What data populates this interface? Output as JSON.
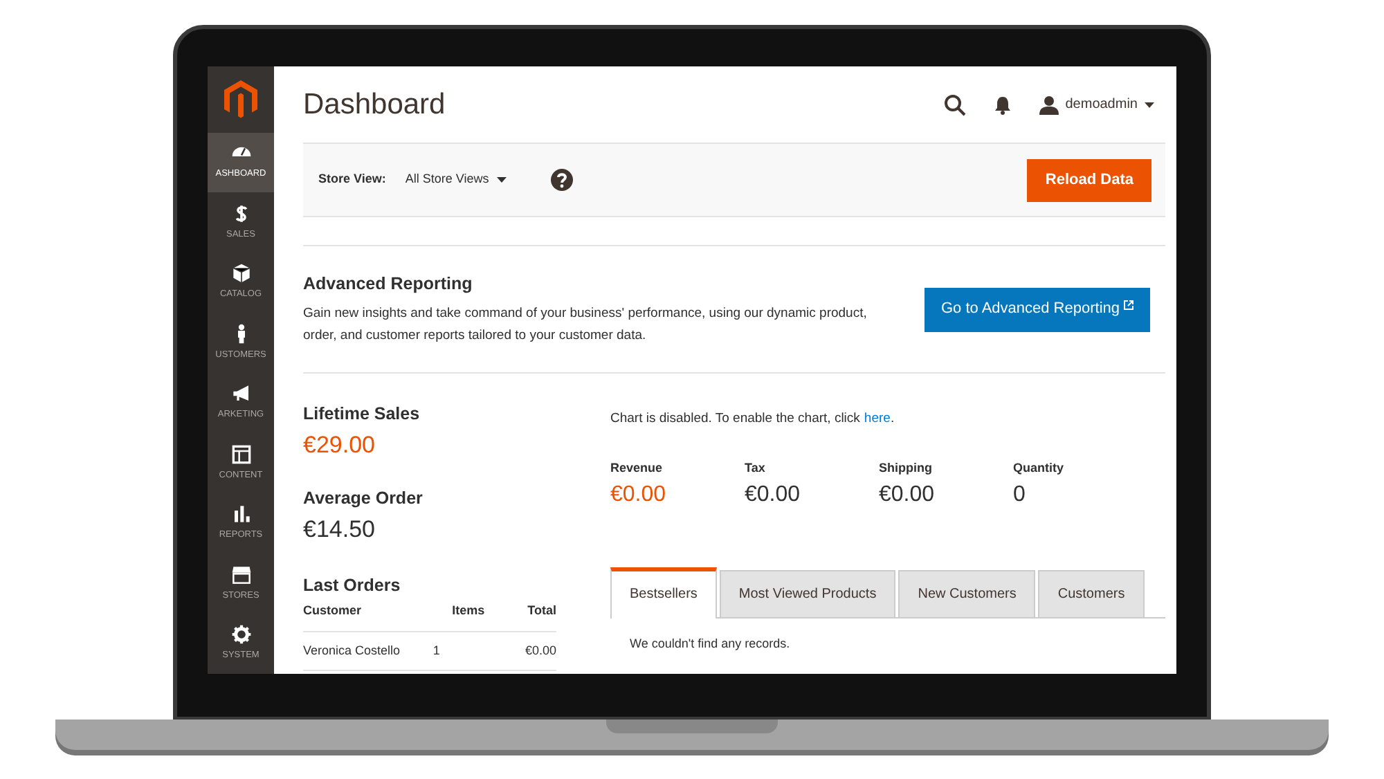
{
  "sidebar": {
    "items": [
      {
        "label": "ASHBOARD",
        "selected": true
      },
      {
        "label": "SALES",
        "selected": false
      },
      {
        "label": "CATALOG",
        "selected": false
      },
      {
        "label": "USTOMERS",
        "selected": false
      },
      {
        "label": "ARKETING",
        "selected": false
      },
      {
        "label": "CONTENT",
        "selected": false
      },
      {
        "label": "REPORTS",
        "selected": false
      },
      {
        "label": "STORES",
        "selected": false
      },
      {
        "label": "SYSTEM",
        "selected": false
      }
    ]
  },
  "header": {
    "title": "Dashboard",
    "user": "demoadmin"
  },
  "store_view": {
    "label": "Store View:",
    "value": "All Store Views",
    "button": "Reload Data"
  },
  "advanced_reporting": {
    "title": "Advanced Reporting",
    "text": "Gain new insights and take command of your business' performance, using our dynamic product, order, and customer reports tailored to your customer data.",
    "button": "Go to Advanced Reporting"
  },
  "lifetime_sales": {
    "label": "Lifetime Sales",
    "value": "€29.00"
  },
  "average_order": {
    "label": "Average Order",
    "value": "€14.50"
  },
  "chart_notice": {
    "text": "Chart is disabled. To enable the chart, click",
    "link": "here",
    "end": "."
  },
  "totals": [
    {
      "label": "Revenue",
      "value": "€0.00",
      "highlight": true
    },
    {
      "label": "Tax",
      "value": "€0.00",
      "highlight": false
    },
    {
      "label": "Shipping",
      "value": "€0.00",
      "highlight": false
    },
    {
      "label": "Quantity",
      "value": "0",
      "highlight": false
    }
  ],
  "last_orders": {
    "title": "Last Orders",
    "columns": [
      "Customer",
      "Items",
      "Total"
    ],
    "rows": [
      [
        "Veronica Costello",
        "1",
        "€0.00"
      ]
    ]
  },
  "tabs": [
    {
      "label": "Bestsellers",
      "selected": true
    },
    {
      "label": "Most Viewed Products",
      "selected": false
    },
    {
      "label": "New Customers",
      "selected": false
    },
    {
      "label": "Customers",
      "selected": false
    }
  ],
  "tab_content": "We couldn't find any records."
}
